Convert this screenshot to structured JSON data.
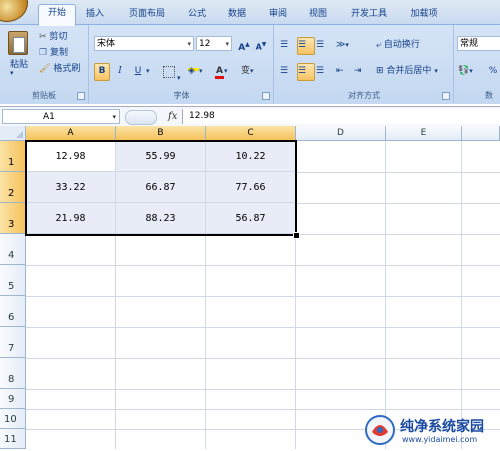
{
  "tabs": [
    "开始",
    "插入",
    "页面布局",
    "公式",
    "数据",
    "审阅",
    "视图",
    "开发工具",
    "加载项"
  ],
  "clipboard": {
    "paste": "粘贴",
    "cut": "剪切",
    "copy": "复制",
    "format_painter": "格式刷",
    "group_label": "剪贴板"
  },
  "font": {
    "name": "宋体",
    "size": "12",
    "bold": "B",
    "italic": "I",
    "underline": "U",
    "group_label": "字体",
    "font_color_letter": "A",
    "wen": "变"
  },
  "alignment": {
    "wrap": "自动换行",
    "merge": "合并后居中",
    "group_label": "对齐方式"
  },
  "number": {
    "format": "常规",
    "percent": "%",
    "group_label": "数"
  },
  "formula_bar": {
    "name_box": "A1",
    "fx": "fx",
    "value": "12.98"
  },
  "columns": [
    "A",
    "B",
    "C",
    "D",
    "E"
  ],
  "rows": [
    "1",
    "2",
    "3",
    "4",
    "5",
    "6",
    "7",
    "8",
    "9",
    "10",
    "11"
  ],
  "table": [
    [
      "12.98",
      "55.99",
      "10.22"
    ],
    [
      "33.22",
      "66.87",
      "77.66"
    ],
    [
      "21.98",
      "88.23",
      "56.87"
    ]
  ],
  "watermark": {
    "title": "纯净系统家园",
    "url": "www.yidaimei.com"
  },
  "colors": {
    "accent": "#15428b",
    "selection_header": "#f5c15a",
    "cell_highlight": "#e8ecf6"
  }
}
